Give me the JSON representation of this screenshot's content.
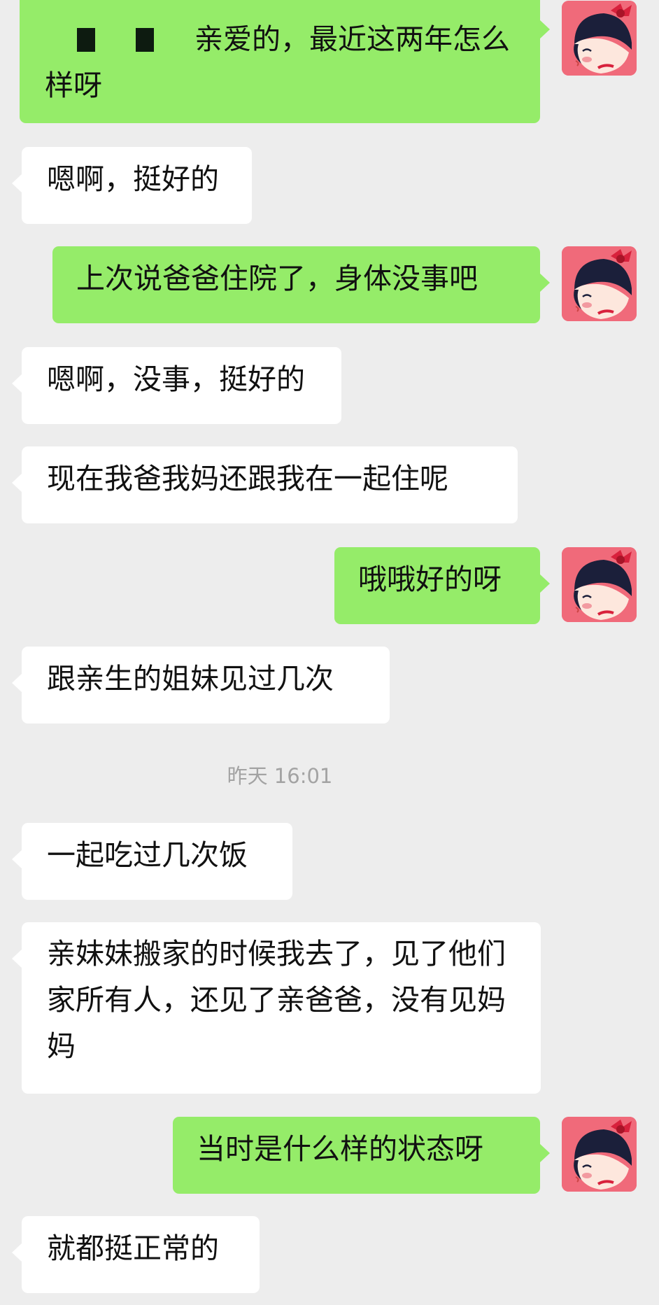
{
  "messages": [
    {
      "side": "out",
      "text": "亲爱的，最近这两年怎么样呀",
      "has_redaction": true
    },
    {
      "side": "in",
      "text": "嗯啊，挺好的"
    },
    {
      "side": "out",
      "text": "上次说爸爸住院了，身体没事吧"
    },
    {
      "side": "in",
      "text": "嗯啊，没事，挺好的"
    },
    {
      "side": "in",
      "text": "现在我爸我妈还跟我在一起住呢"
    },
    {
      "side": "out",
      "text": "哦哦好的呀"
    },
    {
      "side": "in",
      "text": "跟亲生的姐妹见过几次"
    },
    {
      "side": "in",
      "text": "一起吃过几次饭"
    },
    {
      "side": "in",
      "text": "亲妹妹搬家的时候我去了，见了他们家所有人，还见了亲爸爸，没有见妈妈"
    },
    {
      "side": "out",
      "text": "当时是什么样的状态呀"
    },
    {
      "side": "in",
      "text": "就都挺正常的"
    }
  ],
  "timestamp": "昨天 16:01",
  "colors": {
    "background": "#ededed",
    "outgoing_bubble": "#95ec69",
    "incoming_bubble": "#ffffff",
    "avatar_bg": "#f06a7a"
  },
  "avatar_icon": "cartoon-girl-avatar"
}
